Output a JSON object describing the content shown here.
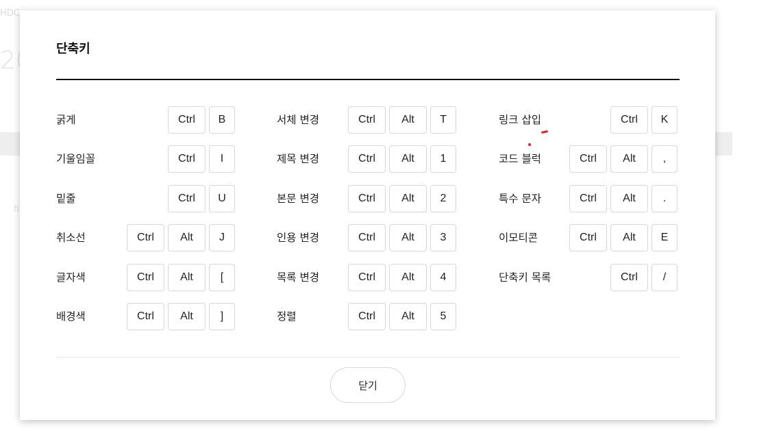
{
  "background": {
    "top_text": "HDC",
    "number_text": "20",
    "left_text": "fi"
  },
  "dialog": {
    "title": "단축키",
    "close_label": "닫기"
  },
  "accent_color": "#e0201e",
  "shortcuts": [
    {
      "label": "굵게",
      "keys": [
        "Ctrl",
        "B"
      ]
    },
    {
      "label": "기울임꼴",
      "keys": [
        "Ctrl",
        "I"
      ]
    },
    {
      "label": "밑줄",
      "keys": [
        "Ctrl",
        "U"
      ]
    },
    {
      "label": "취소선",
      "keys": [
        "Ctrl",
        "Alt",
        "J"
      ]
    },
    {
      "label": "글자색",
      "keys": [
        "Ctrl",
        "Alt",
        "["
      ]
    },
    {
      "label": "배경색",
      "keys": [
        "Ctrl",
        "Alt",
        "]"
      ]
    },
    {
      "label": "서체 변경",
      "keys": [
        "Ctrl",
        "Alt",
        "T"
      ]
    },
    {
      "label": "제목 변경",
      "keys": [
        "Ctrl",
        "Alt",
        "1"
      ]
    },
    {
      "label": "본문 변경",
      "keys": [
        "Ctrl",
        "Alt",
        "2"
      ]
    },
    {
      "label": "인용 변경",
      "keys": [
        "Ctrl",
        "Alt",
        "3"
      ]
    },
    {
      "label": "목록 변경",
      "keys": [
        "Ctrl",
        "Alt",
        "4"
      ]
    },
    {
      "label": "정렬",
      "keys": [
        "Ctrl",
        "Alt",
        "5"
      ]
    },
    {
      "label": "링크 삽입",
      "keys": [
        "Ctrl",
        "K"
      ]
    },
    {
      "label": "코드 블럭",
      "keys": [
        "Ctrl",
        "Alt",
        ","
      ]
    },
    {
      "label": "특수 문자",
      "keys": [
        "Ctrl",
        "Alt",
        "."
      ]
    },
    {
      "label": "이모티콘",
      "keys": [
        "Ctrl",
        "Alt",
        "E"
      ]
    },
    {
      "label": "단축키 목록",
      "keys": [
        "Ctrl",
        "/"
      ]
    }
  ]
}
